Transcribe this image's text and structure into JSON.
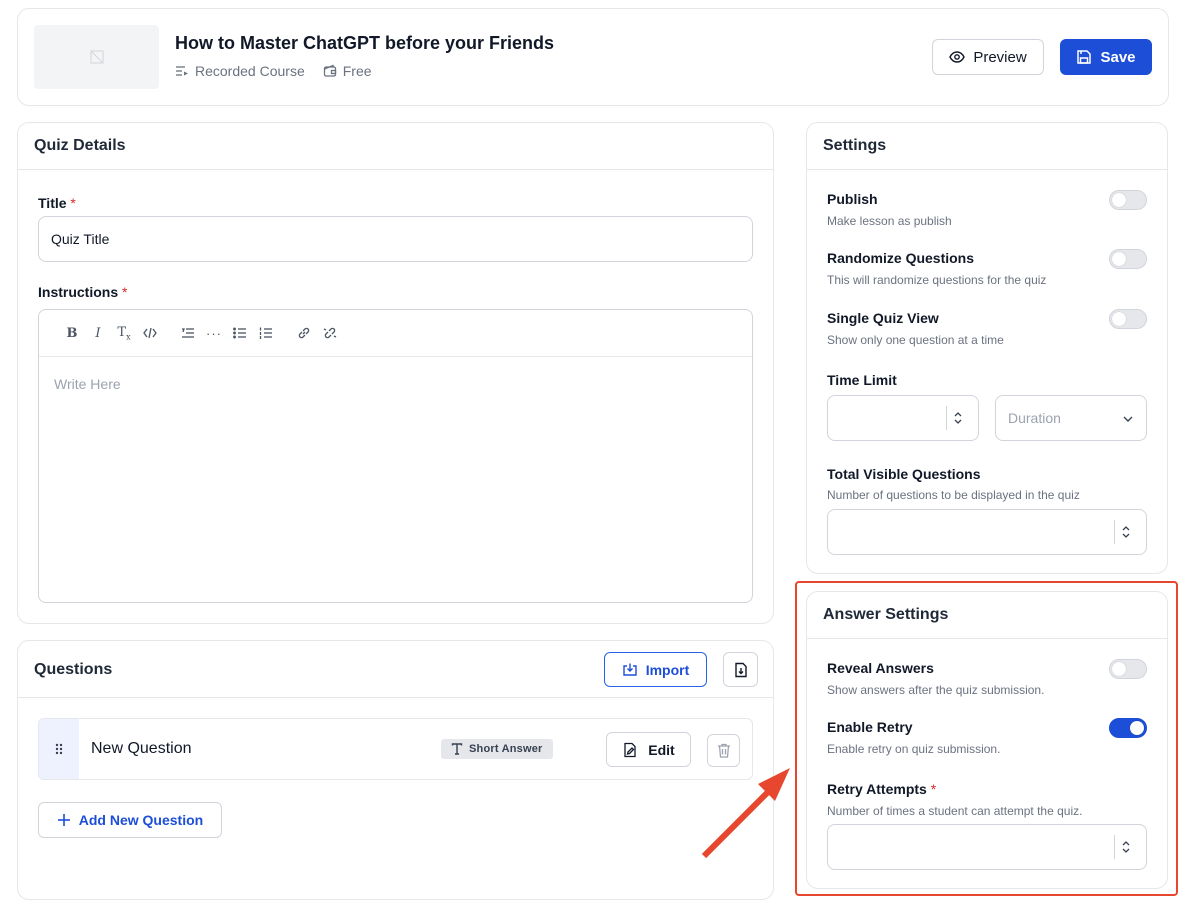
{
  "header": {
    "course_title": "How to Master ChatGPT before your Friends",
    "course_type": "Recorded Course",
    "price": "Free",
    "preview_label": "Preview",
    "save_label": "Save"
  },
  "quiz_details": {
    "card_title": "Quiz Details",
    "title_label": "Title",
    "title_value": "Quiz Title",
    "instructions_label": "Instructions",
    "required_mark": "*",
    "editor_placeholder": "Write Here",
    "toolbar": [
      "bold-icon",
      "italic-icon",
      "clear-format-icon",
      "code-icon",
      "blockquote-icon",
      "more-icon",
      "bullet-list-icon",
      "numbered-list-icon",
      "link-icon",
      "unlink-icon"
    ]
  },
  "questions": {
    "card_title": "Questions",
    "import_label": "Import",
    "items": [
      {
        "title": "New Question",
        "type": "Short Answer",
        "edit_label": "Edit"
      }
    ],
    "add_label": "Add New Question"
  },
  "settings": {
    "card_title": "Settings",
    "publish": {
      "label": "Publish",
      "help": "Make lesson as publish",
      "enabled": false
    },
    "randomize": {
      "label": "Randomize Questions",
      "help": "This will randomize questions for the quiz",
      "enabled": false
    },
    "single_view": {
      "label": "Single Quiz View",
      "help": "Show only one question at a time",
      "enabled": false
    },
    "time_limit": {
      "label": "Time Limit",
      "duration_placeholder": "Duration"
    },
    "visible_questions": {
      "label": "Total Visible Questions",
      "help": "Number of questions to be displayed in the quiz"
    }
  },
  "answer_settings": {
    "card_title": "Answer Settings",
    "reveal": {
      "label": "Reveal Answers",
      "help": "Show answers after the quiz submission.",
      "enabled": false
    },
    "retry": {
      "label": "Enable Retry",
      "help": "Enable retry on quiz submission.",
      "enabled": true
    },
    "retry_attempts": {
      "label": "Retry Attempts",
      "help": "Number of times a student can attempt the quiz."
    }
  },
  "colors": {
    "accent": "#1d4ed8",
    "highlight": "#e8472f",
    "required": "#dc2626"
  }
}
